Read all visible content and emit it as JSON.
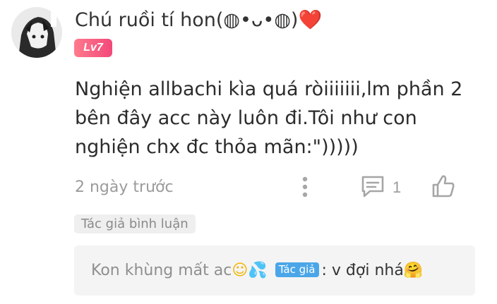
{
  "comment": {
    "username": "Chú ruồi tí hon(◍•ᴗ•◍)",
    "heart_emoji": "❤️",
    "level": "Lv7",
    "text": "Nghiện allbachi kìa quá ròiiiiiii,lm phần 2 bên đây acc này luôn đi.Tôi như con nghiện chx đc thỏa mãn:\")))))",
    "timestamp": "2 ngày trước",
    "reply_count": "1",
    "author_tag": "Tác giả bình luận"
  },
  "reply": {
    "username": "Kon khùng mất ac",
    "emoji_1": "☺",
    "emoji_2": "💦",
    "author_badge": "Tác giả",
    "separator": ":",
    "content": "v đợi nhá",
    "emoji_3": "🤗"
  },
  "icons": {
    "more": "more-vertical-icon",
    "reply": "comment-icon",
    "like": "thumbs-up-icon"
  },
  "colors": {
    "level_badge": "#f2497a",
    "author_badge": "#4aa6e8",
    "heart": "#e0242e"
  }
}
